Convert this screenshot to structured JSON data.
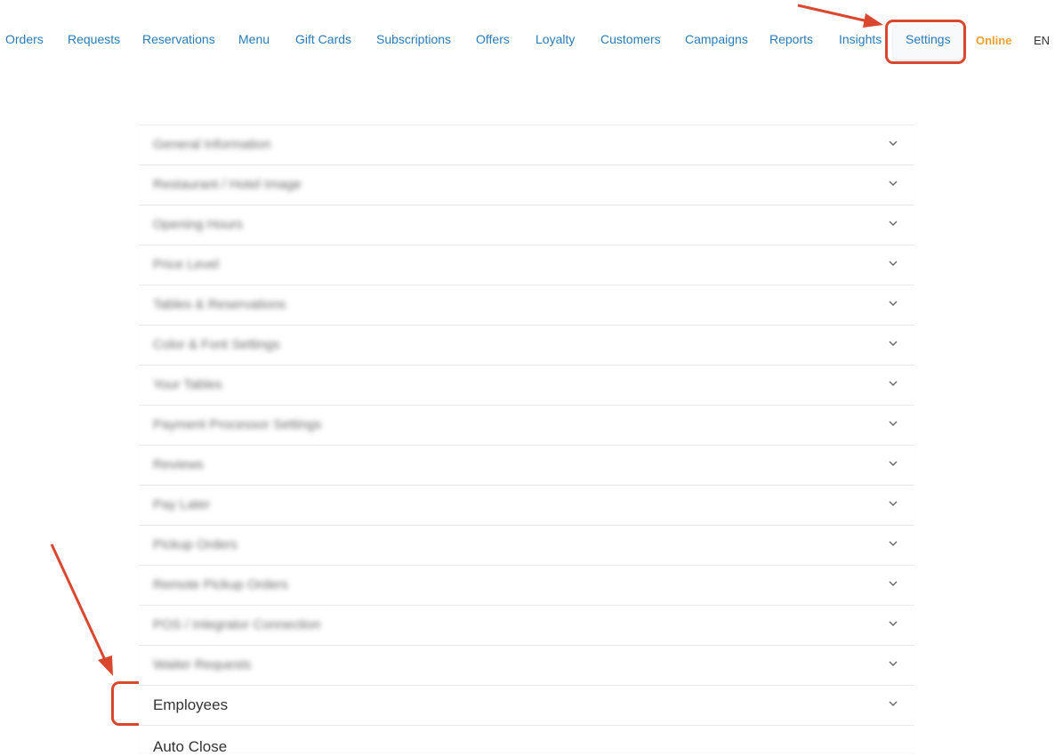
{
  "nav": {
    "items": [
      "Orders",
      "Requests",
      "Reservations",
      "Menu",
      "Gift Cards",
      "Subscriptions",
      "Offers",
      "Loyalty",
      "Customers",
      "Campaigns",
      "Reports",
      "Insights"
    ],
    "settings": "Settings",
    "status": "Online",
    "language": "EN"
  },
  "settings_sections": [
    "General Information",
    "Restaurant / Hotel Image",
    "Opening Hours",
    "Price Level",
    "Tables & Reservations",
    "Color & Font Settings",
    "Your Tables",
    "Payment Processor Settings",
    "Reviews",
    "Pay Later",
    "Pickup Orders",
    "Remote Pickup Orders",
    "POS / Integrator Connection",
    "Waiter Requests",
    "Employees",
    "Auto Close"
  ],
  "colors": {
    "link": "#2a7ab8",
    "online": "#f0a030",
    "highlight": "#d9472e"
  },
  "icons": {
    "expand": "chevron-down-icon"
  }
}
